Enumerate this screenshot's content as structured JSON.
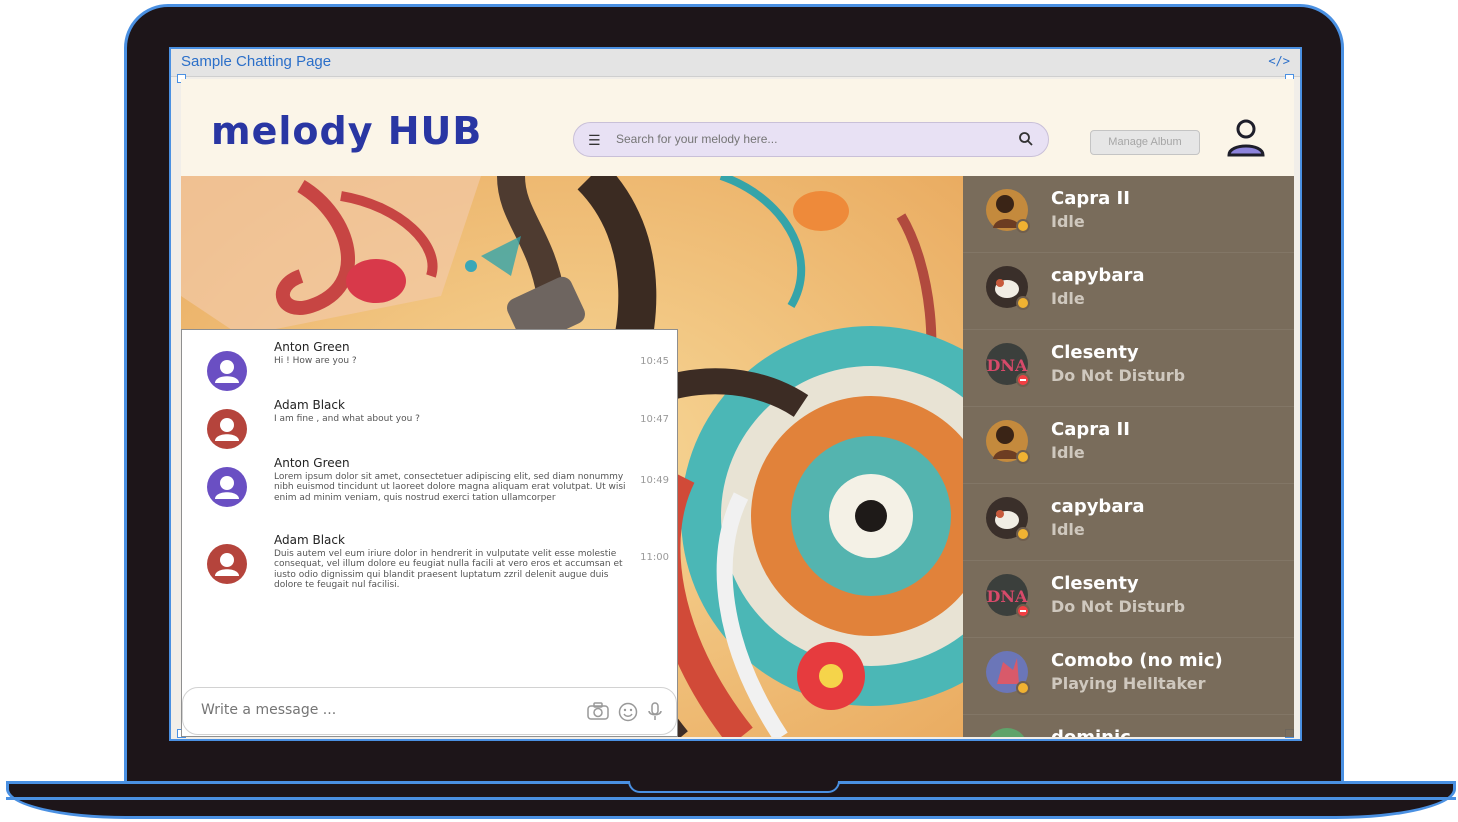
{
  "frame": {
    "title": "Sample Chatting Page",
    "code_icon": "</>"
  },
  "header": {
    "logo": "melody  HUB",
    "search_placeholder": "Search for your melody here...",
    "manage_album_label": "Manage Album"
  },
  "chat": {
    "messages": [
      {
        "name": "Anton Green",
        "text": "Hi ! How are you ?",
        "time": "10:45",
        "avatar_color": "#6a4fc3"
      },
      {
        "name": "Adam Black",
        "text": "I am fine , and what about you ?",
        "time": "10:47",
        "avatar_color": "#b5443c"
      },
      {
        "name": "Anton Green",
        "text": "Lorem ipsum dolor sit amet, consectetuer adipiscing elit, sed diam nonummy nibh euismod tincidunt ut laoreet dolore magna aliquam erat volutpat. Ut wisi enim ad minim veniam, quis nostrud exerci tation ullamcorper",
        "time": "10:49",
        "avatar_color": "#6a4fc3"
      },
      {
        "name": "Adam Black",
        "text": "Duis autem vel eum iriure dolor in hendrerit in vulputate velit esse molestie consequat, vel illum dolore eu feugiat nulla facili at vero eros et accumsan et iusto odio dignissim qui blandit praesent luptatum zzril delenit augue duis dolore te feugait nul facilisi.",
        "time": "11:00",
        "avatar_color": "#b5443c"
      }
    ],
    "composer_placeholder": "Write a message ..."
  },
  "friends": [
    {
      "name": "Capra II",
      "status": "Idle",
      "status_type": "idle"
    },
    {
      "name": "capybara",
      "status": "Idle",
      "status_type": "idle"
    },
    {
      "name": "Clesenty",
      "status": "Do Not Disturb",
      "status_type": "dnd"
    },
    {
      "name": "Capra II",
      "status": "Idle",
      "status_type": "idle"
    },
    {
      "name": "capybara",
      "status": "Idle",
      "status_type": "idle"
    },
    {
      "name": "Clesenty",
      "status": "Do Not Disturb",
      "status_type": "dnd"
    },
    {
      "name": "Comobo (no mic)",
      "status": "Playing Helltaker",
      "status_type": "idle"
    },
    {
      "name": "dominic",
      "status": "",
      "status_type": "online"
    }
  ],
  "colors": {
    "accent": "#4a90e2",
    "logo": "#2936a3",
    "idle": "#f0b232",
    "dnd": "#f23f43"
  }
}
